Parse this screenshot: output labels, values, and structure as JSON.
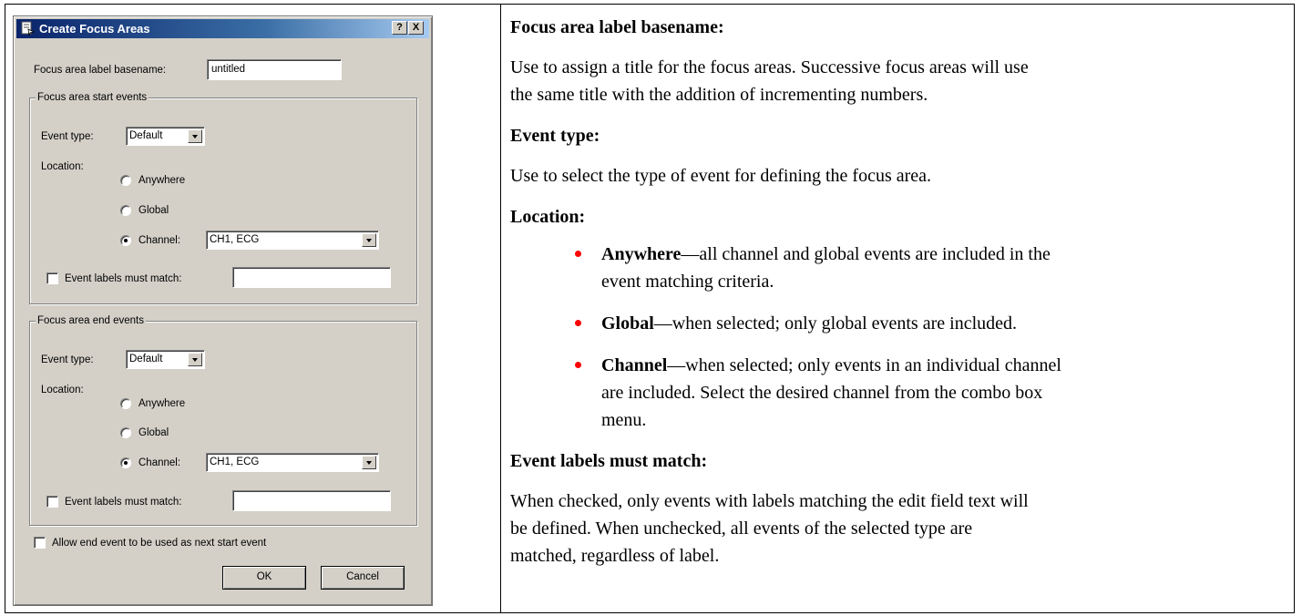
{
  "dialog": {
    "title": "Create Focus Areas",
    "help_btn": "?",
    "close_btn": "X",
    "basename_label": "Focus area label basename:",
    "basename_value": "untitled",
    "start_group": {
      "legend": "Focus area start events",
      "event_type_label": "Event type:",
      "event_type_value": "Default",
      "location_label": "Location:",
      "anywhere": "Anywhere",
      "global": "Global",
      "channel": "Channel:",
      "channel_value": "CH1, ECG",
      "labels_match": "Event labels must match:"
    },
    "end_group": {
      "legend": "Focus area end events",
      "event_type_label": "Event type:",
      "event_type_value": "Default",
      "location_label": "Location:",
      "anywhere": "Anywhere",
      "global": "Global",
      "channel": "Channel:",
      "channel_value": "CH1, ECG",
      "labels_match": "Event labels must match:"
    },
    "allow_end": "Allow end event to be used as next start event",
    "ok": "OK",
    "cancel": "Cancel"
  },
  "help": {
    "h1": "Focus area label basename:",
    "p1a": "Use to assign a title for the focus areas. Successive focus areas will use",
    "p1b": "the same title with the addition of incrementing numbers.",
    "h2": "Event type:",
    "p2": "Use to select the type of event for defining the focus area.",
    "h3": "Location:",
    "b1_bold": "Anywhere",
    "b1a": "—all channel and global events are included in the",
    "b1b": "event matching criteria.",
    "b2_bold": "Global",
    "b2": "—when selected; only global events are included.",
    "b3_bold": "Channel",
    "b3a": "—when selected; only events in an individual channel",
    "b3b": "are included. Select the desired channel from the combo box",
    "b3c": "menu.",
    "h4": "Event labels must match:",
    "p4a": "When checked, only events with labels matching the edit field text will",
    "p4b": "be defined. When unchecked, all events of the selected type are",
    "p4c": "matched, regardless of label."
  },
  "colors": {
    "bullet": "#ff0000",
    "dialog_face": "#d4d0c8",
    "titlebar": "#0a246a"
  }
}
